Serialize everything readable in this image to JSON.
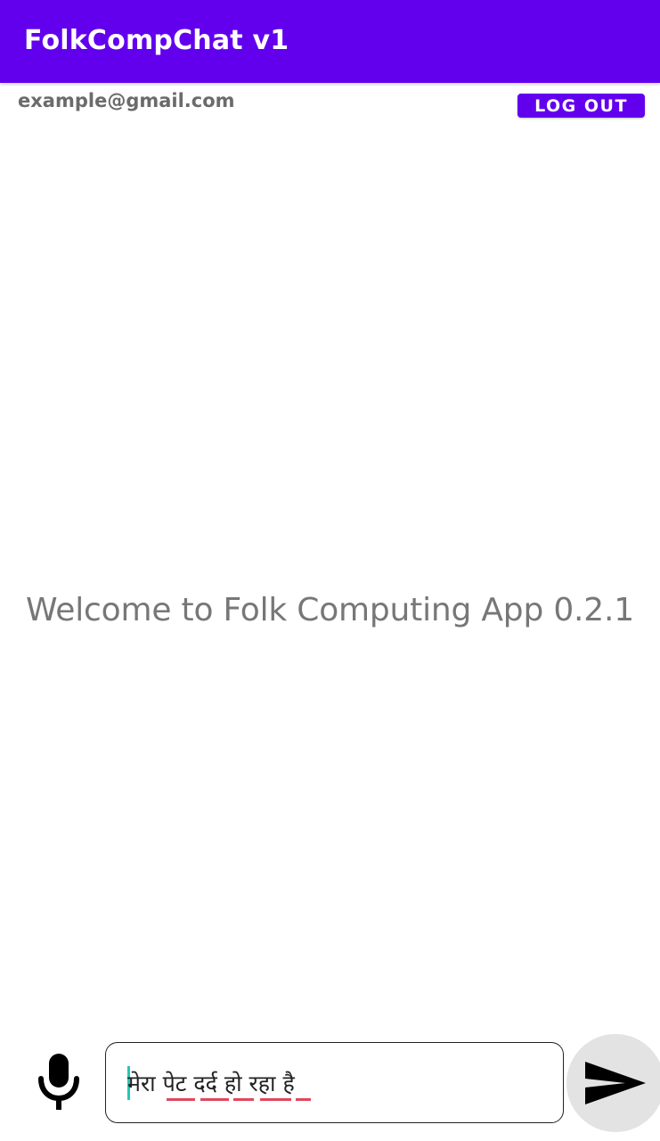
{
  "app_bar": {
    "title": "FolkCompChat v1",
    "background_color": "#6200ee"
  },
  "account": {
    "email": "example@gmail.com",
    "logout_label": "LOG OUT"
  },
  "main": {
    "welcome_text": "Welcome to Folk Computing App 0.2.1"
  },
  "composer": {
    "mic_icon": "microphone-icon",
    "message_value": "मेरा पेट दर्द हो रहा है",
    "send_icon": "send-icon"
  }
}
